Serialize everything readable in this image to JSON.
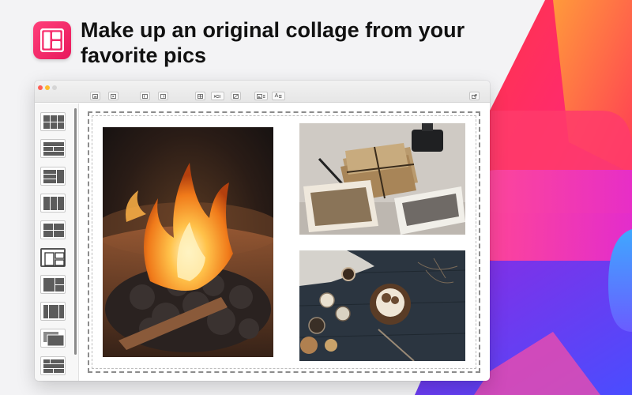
{
  "headline": {
    "line1": "Make up an original collage from your",
    "line2": "favorite pics"
  },
  "app": {
    "icon": "collage-app-icon",
    "accent": "#e8195c"
  },
  "toolbar": {
    "text_button_label": "A",
    "buttons": [
      "add-photo",
      "add-photo-alt",
      "undo",
      "redo",
      "grid-settings",
      "shuffle",
      "remove-background",
      "image-settings",
      "text",
      "share"
    ]
  },
  "sidebar": {
    "layouts": [
      "grid-2x3",
      "grid-rows",
      "grid-mixed",
      "grid-columns",
      "grid-2x2",
      "grid-big-left",
      "grid-big-left-alt",
      "grid-columns-alt",
      "grid-overlap",
      "grid-mixed-alt"
    ],
    "selected": "grid-big-left"
  },
  "collage": {
    "photos": [
      "campfire-photo",
      "old-letters-photo",
      "food-table-photo"
    ]
  }
}
